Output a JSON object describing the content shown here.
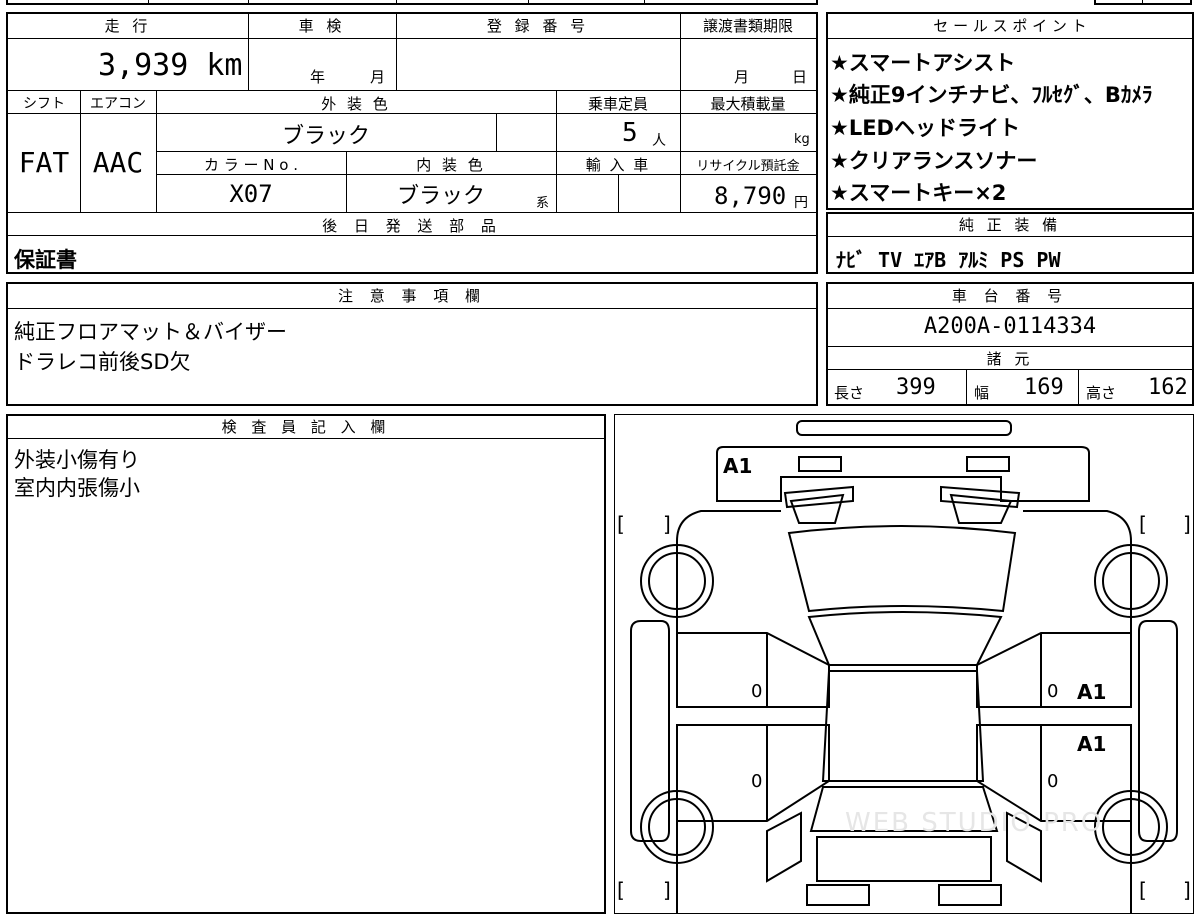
{
  "labels": {
    "mileage": "走 行",
    "inspection": "車 検",
    "registration": "登 録 番 号",
    "transfer": "譲渡書類期限",
    "shift": "シフト",
    "aircon": "エアコン",
    "exterior": "外 装 色",
    "capacity": "乗車定員",
    "max_load": "最大積載量",
    "color_no": "カ ラ ー N o .",
    "interior": "内 装 色",
    "import": "輸 入 車",
    "recycle": "リサイクル預託金",
    "later_parts": "後 日 発 送 部 品",
    "sales_points": "セ ー ル ス ポ イ ン ト",
    "factory_equipment": "純 正 装 備",
    "notes": "注 意 事 項 欄",
    "chassis": "車 台 番 号",
    "specs": "諸 元",
    "inspector": "検 査 員 記 入 欄"
  },
  "values": {
    "mileage": "3,939 km",
    "inspection_year": "年",
    "inspection_month": "月",
    "transfer_month": "月",
    "transfer_day": "日",
    "shift": "FAT",
    "aircon": "AAC",
    "exterior_color": "ブラック",
    "capacity": "5",
    "capacity_unit": "人",
    "max_load_unit": "kg",
    "color_no": "X07",
    "interior_color": "ブラック",
    "interior_suffix": "系",
    "recycle_fee": "8,790",
    "recycle_unit": "円",
    "later_parts": "保証書",
    "factory_equipment": "ﾅﾋﾞ TV ｴｱB ｱﾙﾐ PS PW",
    "chassis_number": "A200A-0114334",
    "length_label": "長さ",
    "length": "399",
    "width_label": "幅",
    "width": "169",
    "height_label": "高さ",
    "height": "162"
  },
  "sales_points": [
    "★スマートアシスト",
    "★純正9インチナビ、ﾌﾙｾｸﾞ、Bｶﾒﾗ",
    "★LEDヘッドライト",
    "★クリアランスソナー",
    "★スマートキー×2"
  ],
  "notes": [
    "純正フロアマット＆バイザー",
    "ドラレコ前後SD欠"
  ],
  "inspector_notes": [
    "外装小傷有り",
    "室内内張傷小"
  ],
  "diagram": {
    "marks": [
      "A1",
      "A1",
      "A1"
    ],
    "zeros": [
      "0",
      "0",
      "0",
      "0"
    ],
    "bracket_open": "[",
    "bracket_close": "]",
    "watermark": "WEB STUDIO PRO"
  }
}
